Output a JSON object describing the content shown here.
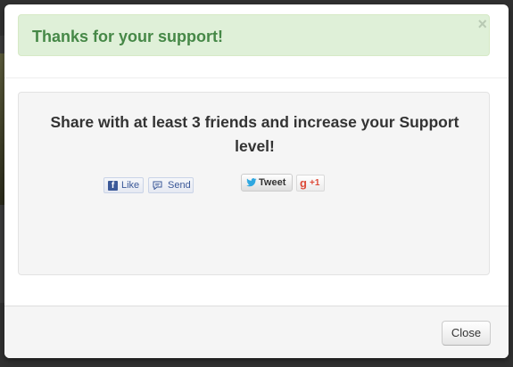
{
  "alert": {
    "message": "Thanks for your support!",
    "close_glyph": "×",
    "color": "#468847",
    "background": "#dff0d8"
  },
  "share": {
    "heading": "Share with at least 3 friends and increase your Support level!",
    "facebook_like_label": "Like",
    "facebook_send_label": "Send",
    "tweet_label": "Tweet",
    "gplus_label": "+1",
    "gplus_glyph": "g",
    "facebook_glyph": "f"
  },
  "footer": {
    "close_label": "Close"
  },
  "icons": {
    "facebook": "facebook-icon",
    "send": "send-icon",
    "twitter": "twitter-bird-icon",
    "gplus": "google-plus-icon",
    "close": "close-icon"
  }
}
